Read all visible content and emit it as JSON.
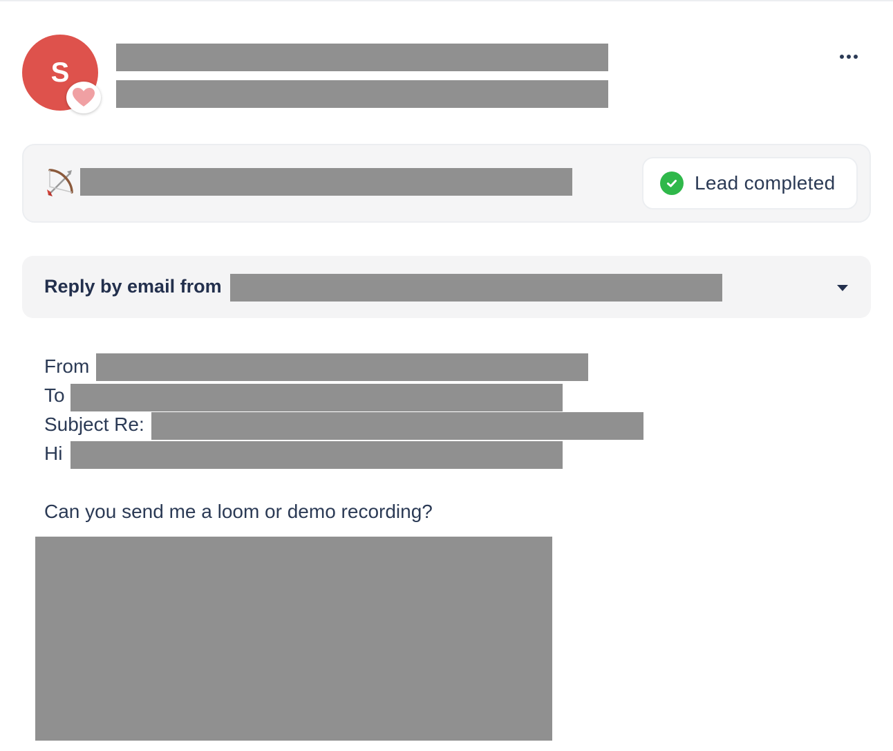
{
  "header": {
    "avatar_initial": "S",
    "avatar_color": "#de524c",
    "badge_icon": "heart-icon",
    "menu_icon": "more-horizontal-icon"
  },
  "lead": {
    "icon": "bow-and-arrow-icon",
    "status_icon": "check-circle-icon",
    "status_label": "Lead completed",
    "status_color": "#2fb84a"
  },
  "reply": {
    "label": "Reply by email from",
    "toggle_icon": "chevron-down-icon"
  },
  "email": {
    "from_label": "From",
    "to_label": "To",
    "subject_label": "Subject Re:",
    "greeting": "Hi",
    "body": "Can you send me a loom or demo recording?"
  }
}
